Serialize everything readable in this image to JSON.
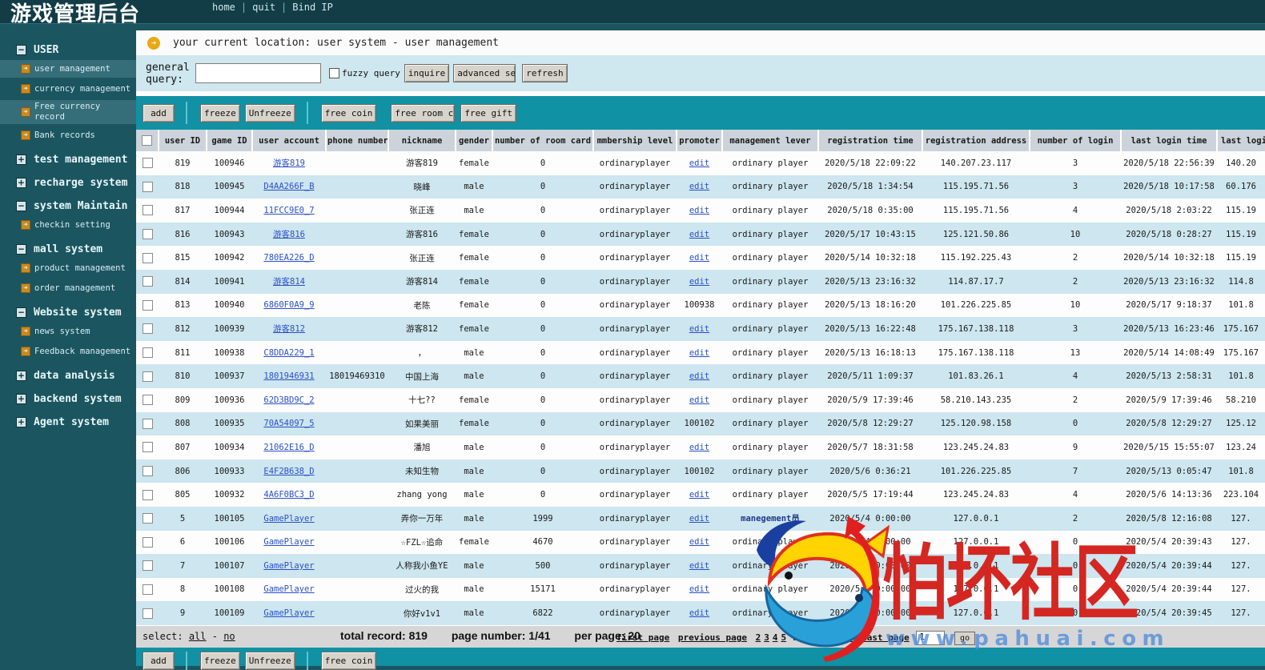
{
  "header": {
    "title": "游戏管理后台",
    "nav": [
      "home",
      "quit",
      "Bind IP"
    ]
  },
  "sidebar": {
    "sections": [
      {
        "label": "USER",
        "state": "expanded",
        "children": [
          {
            "label": "user management",
            "active": true
          },
          {
            "label": "currency management",
            "active": false
          },
          {
            "label": "Free currency record",
            "active": true
          },
          {
            "label": "Bank records",
            "active": false
          }
        ]
      },
      {
        "label": "test management",
        "state": "collapsed",
        "children": []
      },
      {
        "label": "recharge system",
        "state": "collapsed",
        "children": []
      },
      {
        "label": "system Maintain",
        "state": "expanded",
        "children": [
          {
            "label": "checkin setting",
            "active": false
          }
        ]
      },
      {
        "label": "mall system",
        "state": "expanded",
        "children": [
          {
            "label": "product management",
            "active": false
          },
          {
            "label": "order management",
            "active": false
          }
        ]
      },
      {
        "label": "Website system",
        "state": "expanded",
        "children": [
          {
            "label": "news system",
            "active": false
          },
          {
            "label": "Feedback management",
            "active": false
          }
        ]
      },
      {
        "label": "data analysis",
        "state": "collapsed",
        "children": []
      },
      {
        "label": "backend system",
        "state": "collapsed",
        "children": []
      },
      {
        "label": "Agent system",
        "state": "collapsed",
        "children": []
      }
    ]
  },
  "breadcrumb": {
    "text": "your current location: user system - user management"
  },
  "query": {
    "label_line1": "general",
    "label_line2": "query:",
    "input_value": "",
    "fuzzy_label": "fuzzy query",
    "inquire": "inquire",
    "advanced": "advanced search",
    "refresh": "refresh"
  },
  "toolbar": {
    "add": "add",
    "freeze": "freeze",
    "unfreeze": "Unfreeze",
    "free_coin": "free coin",
    "free_room_card": "free room card",
    "free_gift": "free gift"
  },
  "table": {
    "columns": [
      "user ID",
      "game ID",
      "user account",
      "phone number",
      "nickname",
      "gender",
      "number of room card",
      "mmbership level",
      "promoter",
      "management lever",
      "registration time",
      "registration address",
      "number of login",
      "last login time",
      "last login address"
    ],
    "rows": [
      {
        "user_id": "819",
        "game_id": "100946",
        "account": "游客819",
        "phone": "",
        "nickname": "游客819",
        "gender": "female",
        "room_card": "0",
        "membership": "ordinaryplayer",
        "promoter": "edit",
        "promoter_link": true,
        "mgmt": "ordinary player",
        "mgmt_special": false,
        "reg_time": "2020/5/18 22:09:22",
        "reg_addr": "140.207.23.117",
        "login_count": "3",
        "last_time": "2020/5/18 22:56:39",
        "last_addr": "140.20"
      },
      {
        "user_id": "818",
        "game_id": "100945",
        "account": "D4AA266F_B",
        "phone": "",
        "nickname": "晓峰",
        "gender": "male",
        "room_card": "0",
        "membership": "ordinaryplayer",
        "promoter": "edit",
        "promoter_link": true,
        "mgmt": "ordinary player",
        "mgmt_special": false,
        "reg_time": "2020/5/18 1:34:54",
        "reg_addr": "115.195.71.56",
        "login_count": "3",
        "last_time": "2020/5/18 10:17:58",
        "last_addr": "60.176"
      },
      {
        "user_id": "817",
        "game_id": "100944",
        "account": "11FCC9E0_7",
        "phone": "",
        "nickname": "张正连",
        "gender": "male",
        "room_card": "0",
        "membership": "ordinaryplayer",
        "promoter": "edit",
        "promoter_link": true,
        "mgmt": "ordinary player",
        "mgmt_special": false,
        "reg_time": "2020/5/18 0:35:00",
        "reg_addr": "115.195.71.56",
        "login_count": "4",
        "last_time": "2020/5/18 2:03:22",
        "last_addr": "115.19"
      },
      {
        "user_id": "816",
        "game_id": "100943",
        "account": "游客816",
        "phone": "",
        "nickname": "游客816",
        "gender": "female",
        "room_card": "0",
        "membership": "ordinaryplayer",
        "promoter": "edit",
        "promoter_link": true,
        "mgmt": "ordinary player",
        "mgmt_special": false,
        "reg_time": "2020/5/17 10:43:15",
        "reg_addr": "125.121.50.86",
        "login_count": "10",
        "last_time": "2020/5/18 0:28:27",
        "last_addr": "115.19"
      },
      {
        "user_id": "815",
        "game_id": "100942",
        "account": "780EA226_D",
        "phone": "",
        "nickname": "张正连",
        "gender": "female",
        "room_card": "0",
        "membership": "ordinaryplayer",
        "promoter": "edit",
        "promoter_link": true,
        "mgmt": "ordinary player",
        "mgmt_special": false,
        "reg_time": "2020/5/14 10:32:18",
        "reg_addr": "115.192.225.43",
        "login_count": "2",
        "last_time": "2020/5/14 10:32:18",
        "last_addr": "115.19"
      },
      {
        "user_id": "814",
        "game_id": "100941",
        "account": "游客814",
        "phone": "",
        "nickname": "游客814",
        "gender": "female",
        "room_card": "0",
        "membership": "ordinaryplayer",
        "promoter": "edit",
        "promoter_link": true,
        "mgmt": "ordinary player",
        "mgmt_special": false,
        "reg_time": "2020/5/13 23:16:32",
        "reg_addr": "114.87.17.7",
        "login_count": "2",
        "last_time": "2020/5/13 23:16:32",
        "last_addr": "114.8"
      },
      {
        "user_id": "813",
        "game_id": "100940",
        "account": "6860F0A9_9",
        "phone": "",
        "nickname": "老陈",
        "gender": "female",
        "room_card": "0",
        "membership": "ordinaryplayer",
        "promoter": "100938",
        "promoter_link": false,
        "mgmt": "ordinary player",
        "mgmt_special": false,
        "reg_time": "2020/5/13 18:16:20",
        "reg_addr": "101.226.225.85",
        "login_count": "10",
        "last_time": "2020/5/17 9:18:37",
        "last_addr": "101.8"
      },
      {
        "user_id": "812",
        "game_id": "100939",
        "account": "游客812",
        "phone": "",
        "nickname": "游客812",
        "gender": "female",
        "room_card": "0",
        "membership": "ordinaryplayer",
        "promoter": "edit",
        "promoter_link": true,
        "mgmt": "ordinary player",
        "mgmt_special": false,
        "reg_time": "2020/5/13 16:22:48",
        "reg_addr": "175.167.138.118",
        "login_count": "3",
        "last_time": "2020/5/13 16:23:46",
        "last_addr": "175.167"
      },
      {
        "user_id": "811",
        "game_id": "100938",
        "account": "C8DDA229_1",
        "phone": "",
        "nickname": "，",
        "gender": "male",
        "room_card": "0",
        "membership": "ordinaryplayer",
        "promoter": "edit",
        "promoter_link": true,
        "mgmt": "ordinary player",
        "mgmt_special": false,
        "reg_time": "2020/5/13 16:18:13",
        "reg_addr": "175.167.138.118",
        "login_count": "13",
        "last_time": "2020/5/14 14:08:49",
        "last_addr": "175.167"
      },
      {
        "user_id": "810",
        "game_id": "100937",
        "account": "1801946931",
        "phone": "18019469310",
        "nickname": "中国上海",
        "gender": "male",
        "room_card": "0",
        "membership": "ordinaryplayer",
        "promoter": "edit",
        "promoter_link": true,
        "mgmt": "ordinary player",
        "mgmt_special": false,
        "reg_time": "2020/5/11 1:09:37",
        "reg_addr": "101.83.26.1",
        "login_count": "4",
        "last_time": "2020/5/13 2:58:31",
        "last_addr": "101.8"
      },
      {
        "user_id": "809",
        "game_id": "100936",
        "account": "62D3BD9C_2",
        "phone": "",
        "nickname": "十七??",
        "gender": "female",
        "room_card": "0",
        "membership": "ordinaryplayer",
        "promoter": "edit",
        "promoter_link": true,
        "mgmt": "ordinary player",
        "mgmt_special": false,
        "reg_time": "2020/5/9 17:39:46",
        "reg_addr": "58.210.143.235",
        "login_count": "2",
        "last_time": "2020/5/9 17:39:46",
        "last_addr": "58.210"
      },
      {
        "user_id": "808",
        "game_id": "100935",
        "account": "70A54097_5",
        "phone": "",
        "nickname": "如果美丽",
        "gender": "female",
        "room_card": "0",
        "membership": "ordinaryplayer",
        "promoter": "100102",
        "promoter_link": false,
        "mgmt": "ordinary player",
        "mgmt_special": false,
        "reg_time": "2020/5/8 12:29:27",
        "reg_addr": "125.120.98.158",
        "login_count": "0",
        "last_time": "2020/5/8 12:29:27",
        "last_addr": "125.12"
      },
      {
        "user_id": "807",
        "game_id": "100934",
        "account": "21062E16_D",
        "phone": "",
        "nickname": "潘旭",
        "gender": "male",
        "room_card": "0",
        "membership": "ordinaryplayer",
        "promoter": "edit",
        "promoter_link": true,
        "mgmt": "ordinary player",
        "mgmt_special": false,
        "reg_time": "2020/5/7 18:31:58",
        "reg_addr": "123.245.24.83",
        "login_count": "9",
        "last_time": "2020/5/15 15:55:07",
        "last_addr": "123.24"
      },
      {
        "user_id": "806",
        "game_id": "100933",
        "account": "E4F2B638_D",
        "phone": "",
        "nickname": "未知生物",
        "gender": "male",
        "room_card": "0",
        "membership": "ordinaryplayer",
        "promoter": "100102",
        "promoter_link": false,
        "mgmt": "ordinary player",
        "mgmt_special": false,
        "reg_time": "2020/5/6 0:36:21",
        "reg_addr": "101.226.225.85",
        "login_count": "7",
        "last_time": "2020/5/13 0:05:47",
        "last_addr": "101.8"
      },
      {
        "user_id": "805",
        "game_id": "100932",
        "account": "4A6F0BC3_D",
        "phone": "",
        "nickname": "zhang yong",
        "gender": "male",
        "room_card": "0",
        "membership": "ordinaryplayer",
        "promoter": "edit",
        "promoter_link": true,
        "mgmt": "ordinary player",
        "mgmt_special": false,
        "reg_time": "2020/5/5 17:19:44",
        "reg_addr": "123.245.24.83",
        "login_count": "4",
        "last_time": "2020/5/6 14:13:36",
        "last_addr": "223.104"
      },
      {
        "user_id": "5",
        "game_id": "100105",
        "account": "GamePlayer",
        "phone": "",
        "nickname": "弄你一万年",
        "gender": "male",
        "room_card": "1999",
        "membership": "ordinaryplayer",
        "promoter": "edit",
        "promoter_link": true,
        "mgmt": "manegement员",
        "mgmt_special": true,
        "reg_time": "2020/5/4 0:00:00",
        "reg_addr": "127.0.0.1",
        "login_count": "2",
        "last_time": "2020/5/8 12:16:08",
        "last_addr": "127."
      },
      {
        "user_id": "6",
        "game_id": "100106",
        "account": "GamePlayer",
        "phone": "",
        "nickname": "☆FZL☆追命",
        "gender": "female",
        "room_card": "4670",
        "membership": "ordinaryplayer",
        "promoter": "edit",
        "promoter_link": true,
        "mgmt": "ordinary player",
        "mgmt_special": false,
        "reg_time": "2020/5/4 0:00:00",
        "reg_addr": "127.0.0.1",
        "login_count": "0",
        "last_time": "2020/5/4 20:39:43",
        "last_addr": "127."
      },
      {
        "user_id": "7",
        "game_id": "100107",
        "account": "GamePlayer",
        "phone": "",
        "nickname": "人称我小鱼YE",
        "gender": "male",
        "room_card": "500",
        "membership": "ordinaryplayer",
        "promoter": "edit",
        "promoter_link": true,
        "mgmt": "ordinary player",
        "mgmt_special": false,
        "reg_time": "2020/5/4 0:00:00",
        "reg_addr": "127.0.0.1",
        "login_count": "0",
        "last_time": "2020/5/4 20:39:44",
        "last_addr": "127."
      },
      {
        "user_id": "8",
        "game_id": "100108",
        "account": "GamePlayer",
        "phone": "",
        "nickname": "过火的我",
        "gender": "male",
        "room_card": "15171",
        "membership": "ordinaryplayer",
        "promoter": "edit",
        "promoter_link": true,
        "mgmt": "ordinary player",
        "mgmt_special": false,
        "reg_time": "2020/5/4 0:00:00",
        "reg_addr": "127.0.0.1",
        "login_count": "0",
        "last_time": "2020/5/4 20:39:44",
        "last_addr": "127."
      },
      {
        "user_id": "9",
        "game_id": "100109",
        "account": "GamePlayer",
        "phone": "",
        "nickname": "你好v1v1",
        "gender": "male",
        "room_card": "6822",
        "membership": "ordinaryplayer",
        "promoter": "edit",
        "promoter_link": true,
        "mgmt": "ordinary player",
        "mgmt_special": false,
        "reg_time": "2020/5/4 0:00:00",
        "reg_addr": "127.0.0.1",
        "login_count": "0",
        "last_time": "2020/5/4 20:39:45",
        "last_addr": "127."
      }
    ]
  },
  "footer": {
    "select_label": "select:",
    "all": "all",
    "dash": "-",
    "no": "no",
    "total": "total record: 819",
    "page_number": "page number: 1/41",
    "per_page": "per page: 20",
    "pagination": {
      "first": "first page",
      "prev": "previous page",
      "pages": [
        "2",
        "3",
        "4",
        "5"
      ],
      "ellipsis": "…",
      "next": "next page",
      "last": "last page",
      "input_value": "1",
      "go": "go"
    }
  },
  "watermark": {
    "text": "怕坏社区",
    "url": "www.pahuai.com"
  }
}
